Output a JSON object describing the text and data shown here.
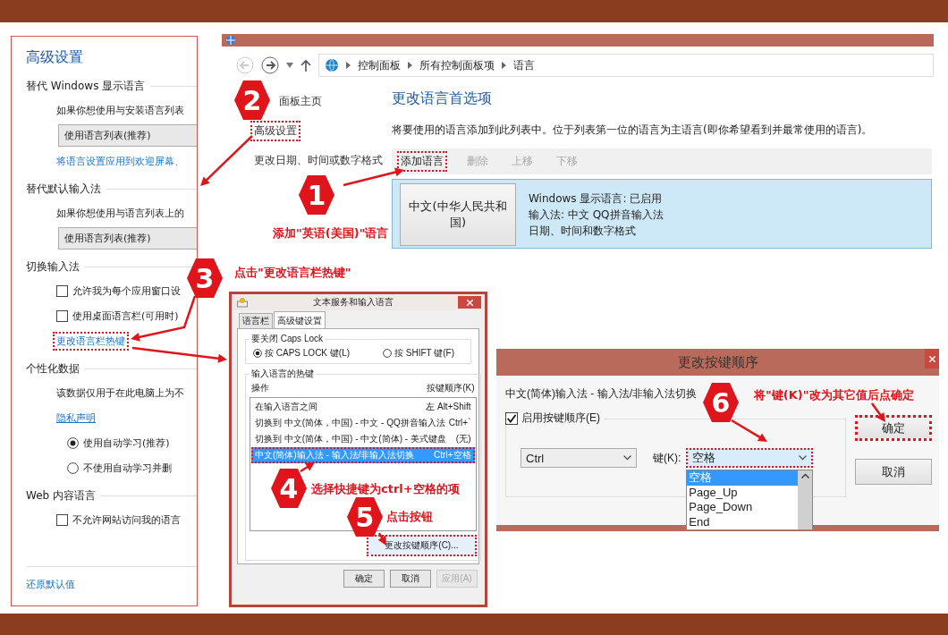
{
  "advanced_settings": {
    "title": "高级设置",
    "sections": [
      {
        "heading": "替代 Windows 显示语言",
        "items": [
          {
            "kind": "text",
            "text": "如果你想使用与安装语言列表"
          },
          {
            "kind": "dropdown",
            "value": "使用语言列表(推荐)"
          },
          {
            "kind": "link",
            "text": "将语言设置应用到欢迎屏幕、",
            "highlighted": false
          }
        ]
      },
      {
        "heading": "替代默认输入法",
        "items": [
          {
            "kind": "text",
            "text": "如果你想使用与语言列表上的"
          },
          {
            "kind": "dropdown",
            "value": "使用语言列表(推荐)"
          }
        ]
      },
      {
        "heading": "切换输入法",
        "items": [
          {
            "kind": "checkbox",
            "text": "允许我为每个应用窗口设",
            "checked": false
          },
          {
            "kind": "checkbox",
            "text": "使用桌面语言栏(可用时)",
            "checked": false
          },
          {
            "kind": "link",
            "text": "更改语言栏热键",
            "highlighted": true
          }
        ]
      },
      {
        "heading": "个性化数据",
        "items": [
          {
            "kind": "text",
            "text": "该数据仅用于在此电脑上为不"
          },
          {
            "kind": "underlined-link",
            "text": "隐私声明",
            "highlighted": false
          },
          {
            "kind": "radio",
            "text": "使用自动学习(推荐)",
            "selected": true
          },
          {
            "kind": "radio",
            "text": "不使用自动学习并删",
            "selected": false
          }
        ]
      },
      {
        "heading": "Web 内容语言",
        "items": [
          {
            "kind": "checkbox",
            "text": "不允许网站访问我的语言",
            "checked": false
          }
        ]
      }
    ],
    "footer_link": "还原默认值"
  },
  "language_window": {
    "breadcrumb": [
      "控制面板",
      "所有控制面板项",
      "语言"
    ],
    "sidebar_links": [
      {
        "label": "面板主页",
        "highlighted": false
      },
      {
        "label": "高级设置",
        "highlighted": true
      },
      {
        "label": "更改日期、时间或数字格式",
        "highlighted": false
      }
    ],
    "heading": "更改语言首选项",
    "description": "将要使用的语言添加到此列表中。位于列表第一位的语言为主语言(即你希望看到并最常使用的语言)。",
    "toolbar": [
      {
        "label": "添加语言",
        "disabled": false,
        "highlighted": true
      },
      {
        "label": "删除",
        "disabled": true,
        "highlighted": false
      },
      {
        "label": "上移",
        "disabled": true,
        "highlighted": false
      },
      {
        "label": "下移",
        "disabled": true,
        "highlighted": false
      }
    ],
    "language": {
      "name": "中文(中华人民共和国)",
      "details": [
        "Windows 显示语言: 已启用",
        "输入法: 中文 QQ拼音输入法",
        "日期、时间和数字格式"
      ]
    }
  },
  "services_dialog": {
    "title": "文本服务和输入语言",
    "tabs": [
      {
        "label": "语言栏",
        "selected": false
      },
      {
        "label": "高级键设置",
        "selected": true
      }
    ],
    "caps_lock": {
      "title": "要关闭 Caps Lock",
      "options": [
        {
          "label": "按 CAPS LOCK 键(L)",
          "selected": true
        },
        {
          "label": "按 SHIFT 键(F)",
          "selected": false
        }
      ]
    },
    "hotkeys": {
      "title": "输入语言的热键",
      "columns": [
        "操作",
        "按键顺序(K)"
      ],
      "rows": [
        {
          "action": "在输入语言之间",
          "keys": "左 Alt+Shift",
          "selected": false,
          "highlighted": false
        },
        {
          "action": "切换到 中文(简体，中国) - 中文 - QQ拼音输入法",
          "keys": "Ctrl+`",
          "selected": false,
          "highlighted": false
        },
        {
          "action": "切换到 中文(简体，中国) - 中文(简体) - 美式键盘",
          "keys": "(无)",
          "selected": false,
          "highlighted": false
        },
        {
          "action": "中文(简体)输入法 - 输入法/非输入法切换",
          "keys": "Ctrl+空格",
          "selected": true,
          "highlighted": true
        }
      ]
    },
    "change_button": {
      "label": "更改按键顺序(C)...",
      "highlighted": true
    },
    "buttons": [
      {
        "label": "确定",
        "disabled": false
      },
      {
        "label": "取消",
        "disabled": false
      },
      {
        "label": "应用(A)",
        "disabled": true
      }
    ]
  },
  "key_dialog": {
    "title": "更改按键顺序",
    "description": "中文(简体)输入法 - 输入法/非输入法切换",
    "enable": {
      "label": "启用按键顺序(E)",
      "checked": true
    },
    "modifier": "Ctrl",
    "key_label": "键(K):",
    "key_value": "空格",
    "key_highlighted": true,
    "options": [
      {
        "label": "空格",
        "selected": true
      },
      {
        "label": "Page_Up",
        "selected": false
      },
      {
        "label": "Page_Down",
        "selected": false
      },
      {
        "label": "End",
        "selected": false
      }
    ],
    "buttons": [
      {
        "label": "确定",
        "highlighted": true
      },
      {
        "label": "取消",
        "highlighted": false
      }
    ]
  },
  "steps": [
    {
      "number": "1",
      "caption": "添加\"英语(美国)\"语言"
    },
    {
      "number": "2"
    },
    {
      "number": "3",
      "caption": "点击\"更改语言栏热键\""
    },
    {
      "number": "4",
      "caption": "选择快捷键为ctrl+空格的项"
    },
    {
      "number": "5",
      "caption": "点击按钮"
    },
    {
      "number": "6",
      "caption": "将\"键(K)\"改为其它值后点确定"
    }
  ]
}
